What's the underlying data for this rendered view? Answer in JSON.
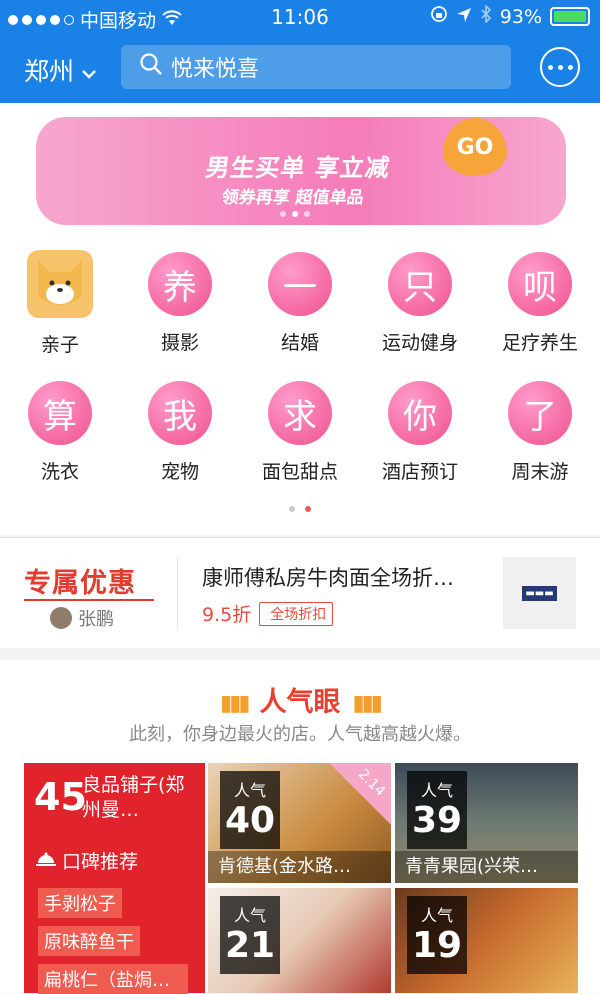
{
  "status_bar": {
    "carrier": "中国移动",
    "time": "11:06",
    "battery": "93%"
  },
  "nav": {
    "city": "郑州",
    "search_placeholder": "悦来悦喜"
  },
  "banner": {
    "line1": "男生买单 享立减",
    "line2": "领券再享 超值单品",
    "badge": "GO"
  },
  "categories": [
    {
      "label": "亲子",
      "glyph": ""
    },
    {
      "label": "摄影",
      "glyph": "养"
    },
    {
      "label": "结婚",
      "glyph": "一"
    },
    {
      "label": "运动健身",
      "glyph": "只"
    },
    {
      "label": "足疗养生",
      "glyph": "呗"
    },
    {
      "label": "洗衣",
      "glyph": "算"
    },
    {
      "label": "宠物",
      "glyph": "我"
    },
    {
      "label": "面包甜点",
      "glyph": "求"
    },
    {
      "label": "酒店预订",
      "glyph": "你"
    },
    {
      "label": "周末游",
      "glyph": "了"
    }
  ],
  "deal": {
    "section_logo": "专属优惠",
    "user": "张鹏",
    "title": "康师傅私房牛肉面全场折…",
    "price": "9.5折",
    "tag": "全场折扣"
  },
  "popular": {
    "title": "人气眼",
    "subtitle": "此刻，你身边最火的店。人气越高越火爆。",
    "featured": {
      "score": "45",
      "name": "良品铺子(郑州曼…",
      "recommend_label": "口碑推荐",
      "items": [
        "手剥松子",
        "原味醉鱼干",
        "扁桃仁（盐焗…"
      ]
    },
    "tiles": [
      {
        "label": "人气",
        "score": "40",
        "name": "肯德基(金水路…",
        "ribbon": "2.14"
      },
      {
        "label": "人气",
        "score": "39",
        "name": "青青果园(兴荣…"
      },
      {
        "label": "人气",
        "score": "21",
        "name": ""
      },
      {
        "label": "人气",
        "score": "19",
        "name": ""
      }
    ]
  },
  "colors": {
    "primary": "#1a82e6",
    "accent": "#e1232b",
    "pink": "#f0508f"
  }
}
